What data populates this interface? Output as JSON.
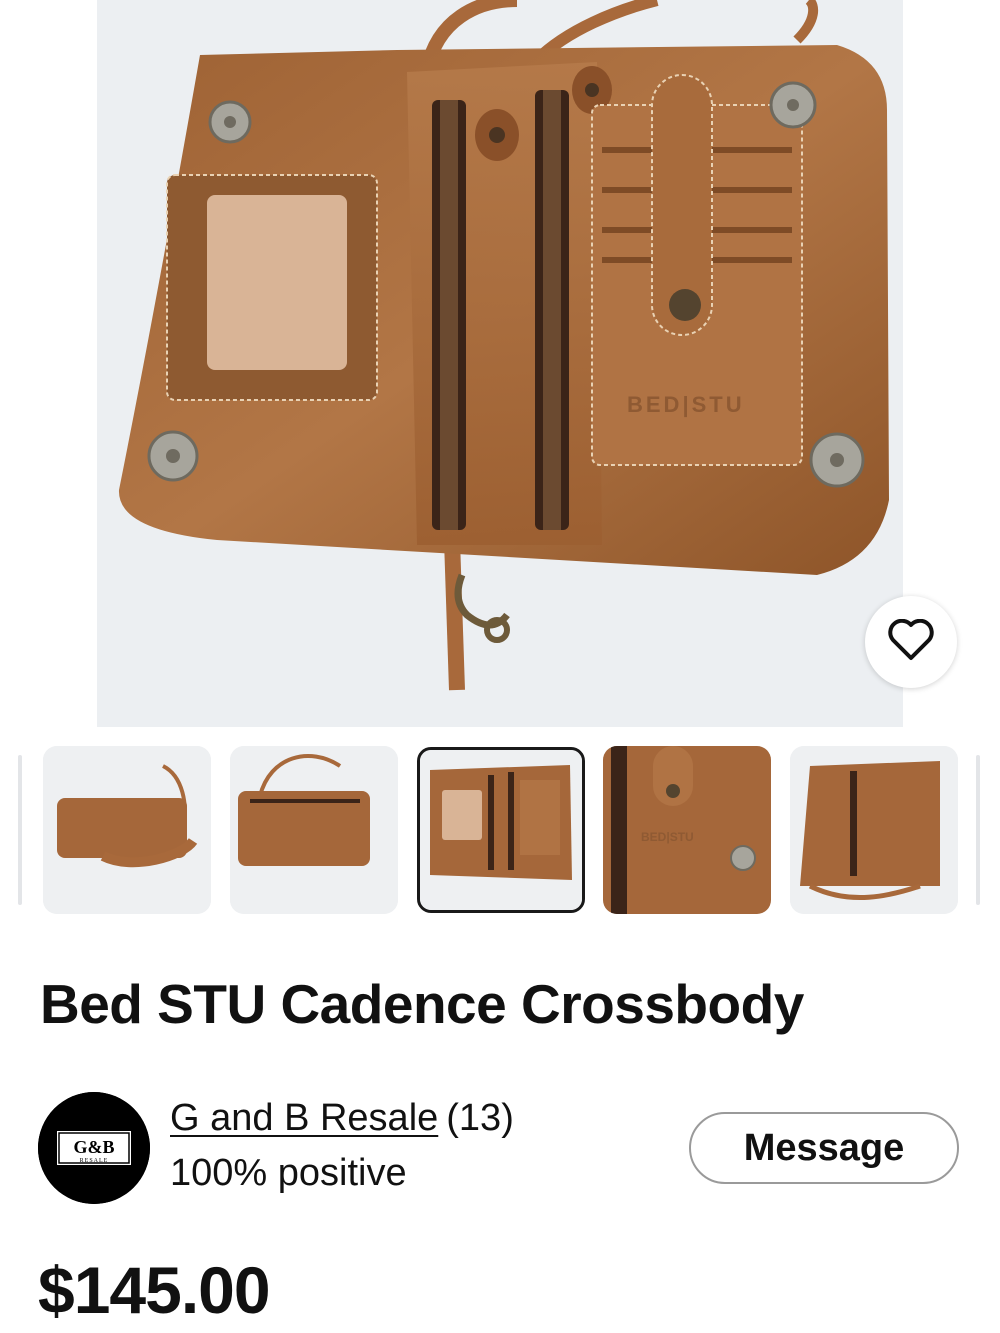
{
  "listing": {
    "title": "Bed STU Cadence Crossbody",
    "price": "$145.00",
    "photo_brand_emboss": "BED|STU"
  },
  "gallery": {
    "selected_index": 2,
    "thumbnails": [
      {
        "label": "thumbnail-closed-front"
      },
      {
        "label": "thumbnail-back-zipper"
      },
      {
        "label": "thumbnail-open-interior"
      },
      {
        "label": "thumbnail-card-slots-closeup"
      },
      {
        "label": "thumbnail-side-zipper"
      }
    ]
  },
  "seller": {
    "name": "G and B Resale",
    "count": "(13)",
    "feedback": "100% positive",
    "logo_text": "G&B",
    "logo_subtext": "RESALE"
  },
  "actions": {
    "message_label": "Message",
    "favorite_icon": "heart-outline-icon"
  },
  "colors": {
    "leather": "#a5673a",
    "leather_dark": "#7d4a25",
    "background": "#ffffff",
    "text": "#111111"
  }
}
